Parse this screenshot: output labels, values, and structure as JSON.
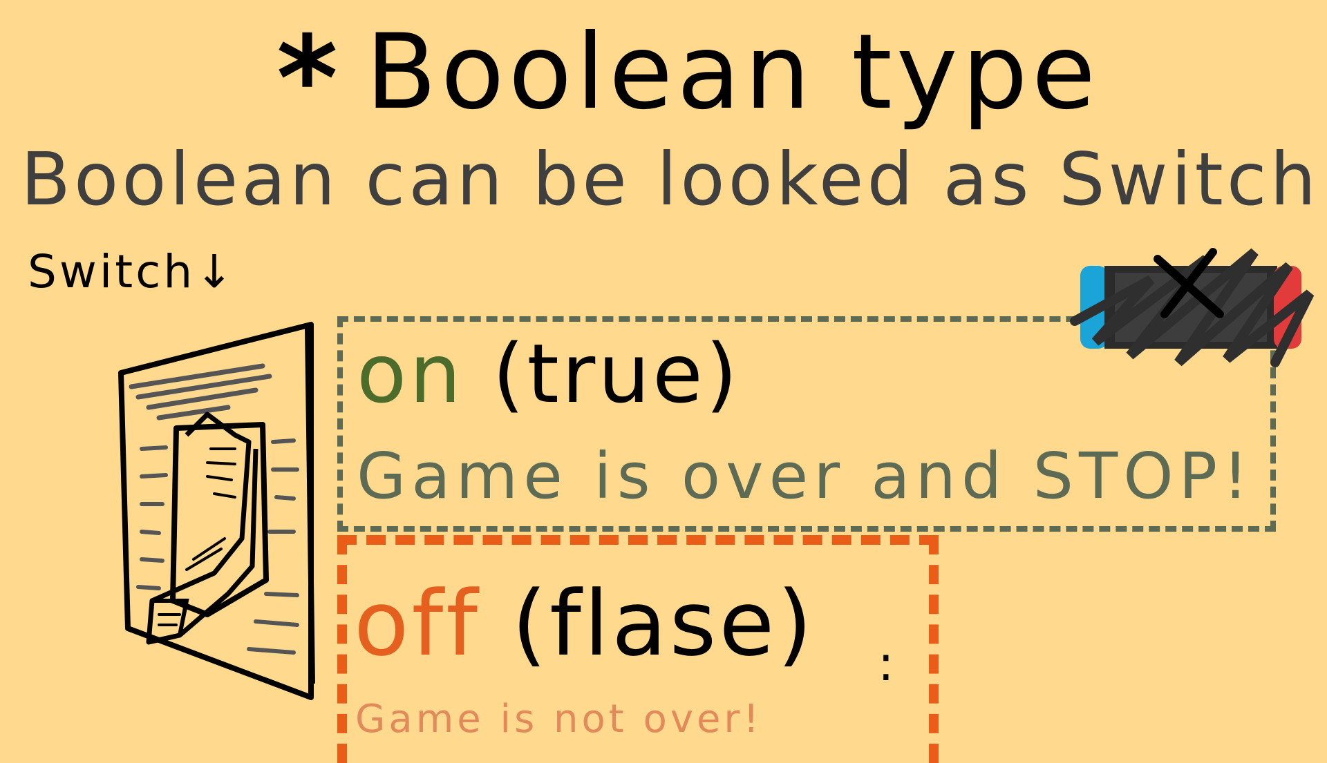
{
  "title": {
    "star": "*",
    "text": "Boolean type"
  },
  "subtitle": "Boolean can be looked as Switch",
  "switch_label": "Switch↓",
  "on_state": {
    "keyword": "on",
    "value": "(true)",
    "description": "Game is over and STOP!"
  },
  "off_state": {
    "keyword": "off",
    "value": "(flase)",
    "trailing": ":",
    "description": "Game is not over!"
  },
  "colors": {
    "background": "#FFD98E",
    "on_green": "#4b6c2a",
    "on_box": "#5e6b54",
    "off_orange": "#E5601E",
    "off_desc": "#E28A5A"
  },
  "icons": [
    "light-switch-icon",
    "game-console-icon",
    "cross-out-icon"
  ]
}
